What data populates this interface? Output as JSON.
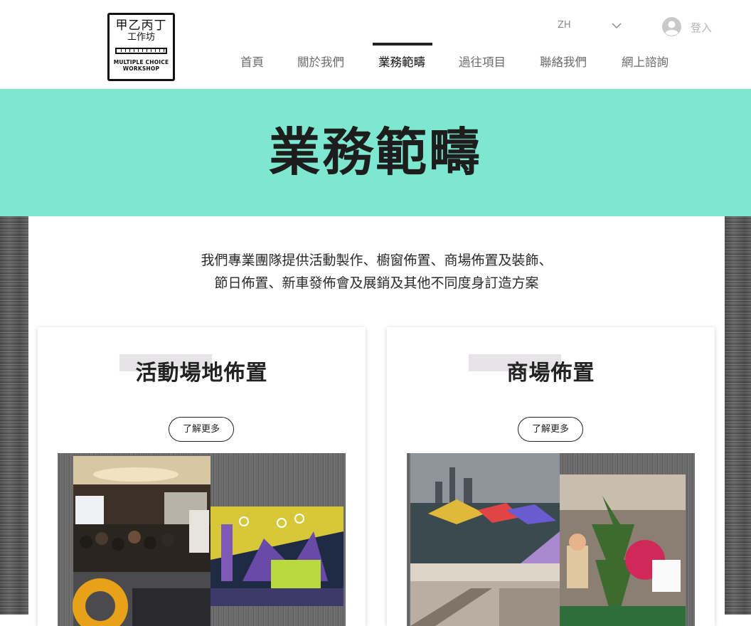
{
  "logo": {
    "cn_line1": "甲乙丙丁",
    "cn_line2": "工作坊",
    "en_line1": "MULTIPLE CHOICE",
    "en_line2": "WORKSHOP"
  },
  "header": {
    "language": "ZH",
    "login_label": "登入"
  },
  "nav": {
    "items": [
      {
        "label": "首頁"
      },
      {
        "label": "關於我們"
      },
      {
        "label": "業務範疇"
      },
      {
        "label": "過往項目"
      },
      {
        "label": "聯絡我們"
      },
      {
        "label": "網上諮詢"
      }
    ],
    "active_index": 2
  },
  "hero": {
    "title": "業務範疇"
  },
  "intro": {
    "line1": "我們專業團隊提供活動製作、櫥窗佈置、商場佈置及裝飾、",
    "line2": "節日佈置、新車發佈會及展銷及其他不同度身訂造方案"
  },
  "cards": [
    {
      "title": "活動場地佈置",
      "button_label": "了解更多"
    },
    {
      "title": "商場佈置",
      "button_label": "了解更多"
    }
  ],
  "colors": {
    "hero_background": "#7de8cf",
    "text_dark": "#1d1d1d",
    "nav_text": "#6b6b6b"
  },
  "icons": {
    "language_dropdown": "chevron-down-icon",
    "login": "user-avatar-icon"
  }
}
